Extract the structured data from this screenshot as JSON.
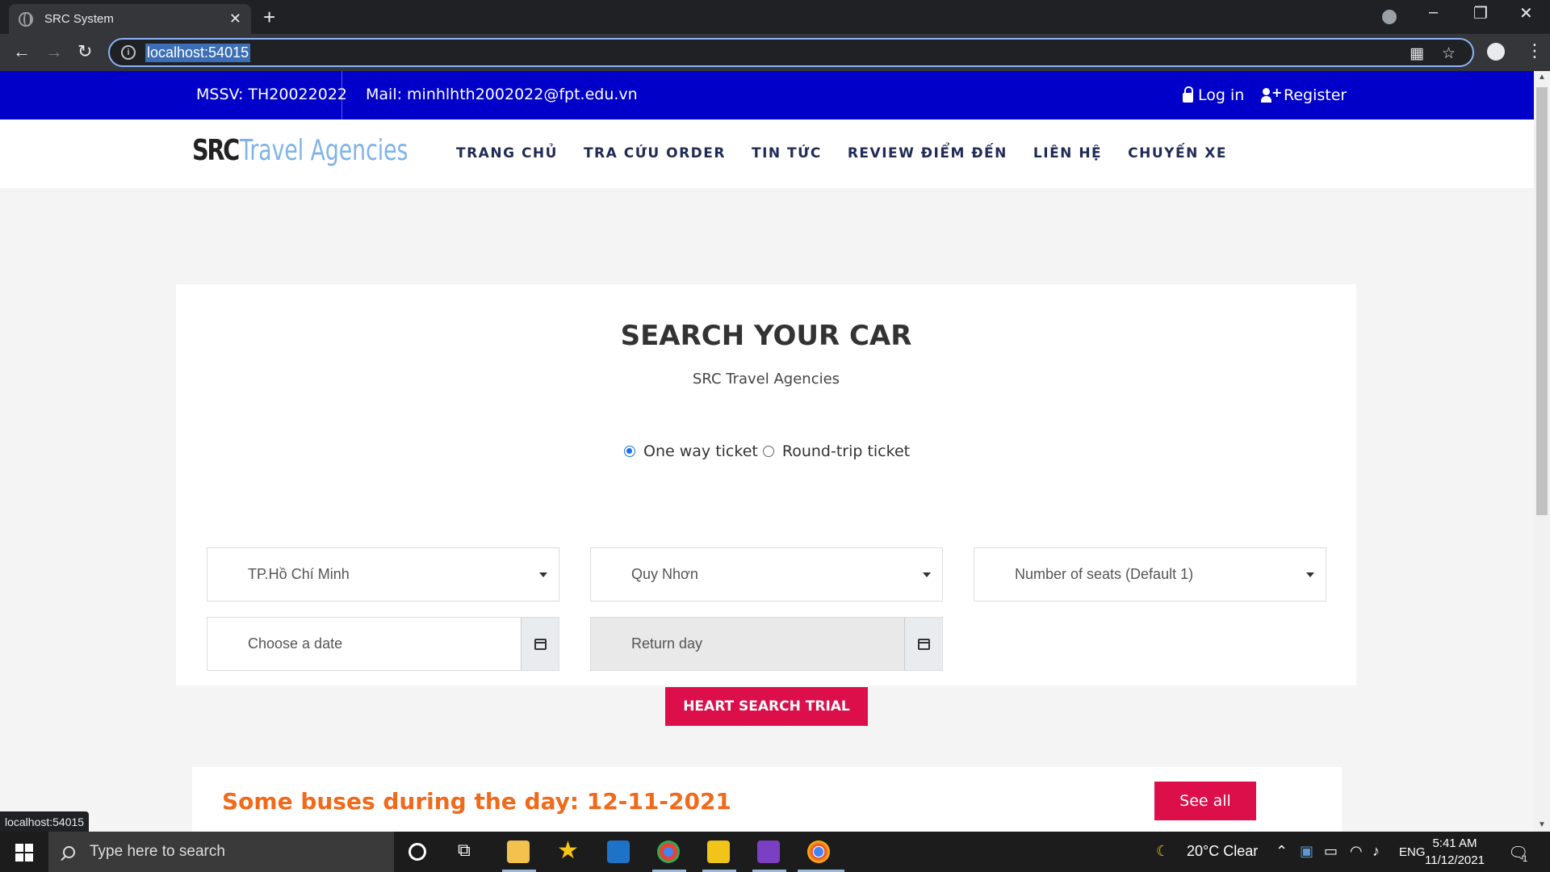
{
  "browser": {
    "tab_title": "SRC System",
    "tab_close": "✕",
    "new_tab": "+",
    "url": "localhost:54015",
    "status_url": "localhost:54015"
  },
  "topbar": {
    "mssv": "MSSV: TH20022022",
    "mail": "Mail: minhlhth2002022@fpt.edu.vn",
    "login": "Log in",
    "register": "Register"
  },
  "logo": {
    "part1": "SRC",
    "part2": "Travel Agencies"
  },
  "menu": [
    "TRANG CHỦ",
    "TRA CỨU ORDER",
    "TIN TỨC",
    "REVIEW ĐIỂM ĐẾN",
    "LIÊN HỆ",
    "CHUYẾN XE"
  ],
  "search": {
    "title": "SEARCH YOUR CAR",
    "subtitle": "SRC Travel Agencies",
    "one_way": "One way ticket",
    "round_trip": "Round-trip ticket",
    "from": "TP.Hồ Chí Minh",
    "to": "Quy Nhơn",
    "seats": "Number of seats (Default 1)",
    "date_placeholder": "Choose a date",
    "return_placeholder": "Return day",
    "button": "HEART SEARCH TRIAL"
  },
  "buses": {
    "title": "Some buses during the day: 12-11-2021",
    "see_all": "See all"
  },
  "taskbar": {
    "search_placeholder": "Type here to search",
    "weather": "20°C  Clear",
    "lang": "ENG",
    "time": "5:41 AM",
    "date": "11/12/2021",
    "notif_count": "1"
  },
  "colors": {
    "topbar": "#0000c8",
    "accent": "#dc0f4a",
    "orange": "#f06a1c",
    "nav_text": "#1f2a55"
  }
}
